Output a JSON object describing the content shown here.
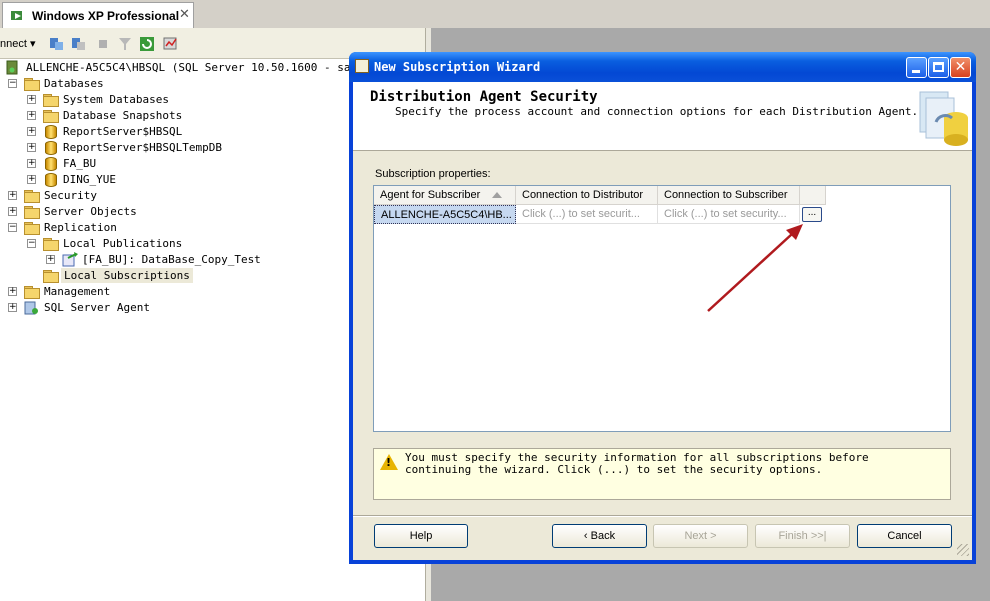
{
  "tab": {
    "title": "Windows XP Professional",
    "close": "✕"
  },
  "toolbar": {
    "connect_label": "nnect ▾"
  },
  "tree": {
    "server": "ALLENCHE-A5C5C4\\HBSQL (SQL Server 10.50.1600 - sa)",
    "databases": "Databases",
    "system_databases": "System Databases",
    "database_snapshots": "Database Snapshots",
    "db1": "ReportServer$HBSQL",
    "db2": "ReportServer$HBSQLTempDB",
    "db3": "FA_BU",
    "db4": "DING_YUE",
    "security": "Security",
    "server_objects": "Server Objects",
    "replication": "Replication",
    "local_publications": "Local Publications",
    "publication": "[FA_BU]: DataBase_Copy_Test",
    "local_subscriptions": "Local Subscriptions",
    "management": "Management",
    "sql_agent": "SQL Server Agent"
  },
  "wizard": {
    "title": "New Subscription Wizard",
    "header_title": "Distribution Agent Security",
    "header_subtitle": "Specify the process account and connection options for each Distribution Agent.",
    "subscription_properties": "Subscription properties:",
    "columns": [
      "Agent for Subscriber",
      "Connection to Distributor",
      "Connection to Subscriber"
    ],
    "row": {
      "agent": "ALLENCHE-A5C5C4\\HB...",
      "distributor": "Click (...) to set securit...",
      "subscriber": "Click (...) to set security...",
      "ellipsis": "..."
    },
    "warning": "You must specify the security information for all subscriptions before continuing the wizard. Click (...) to set the security options.",
    "buttons": {
      "help": "Help",
      "back": "Back",
      "next": "Next >",
      "finish": "Finish >>|",
      "cancel": "Cancel"
    }
  },
  "colors": {
    "xp_title_blue": "#0a5fe0",
    "arrow_red": "#c0191e",
    "folder": "#f5d56c"
  }
}
